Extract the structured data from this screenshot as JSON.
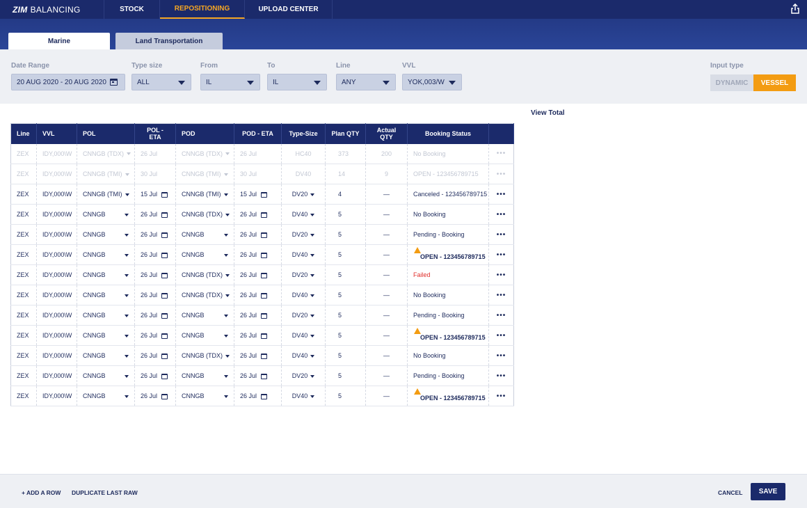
{
  "brand": {
    "bold": "ZIM",
    "name": "BALANCING"
  },
  "nav": {
    "tabs": [
      "STOCK",
      "REPOSITIONING",
      "UPLOAD CENTER"
    ],
    "active": "REPOSITIONING"
  },
  "subtabs": {
    "marine": "Marine",
    "land": "Land Transportation"
  },
  "filters": {
    "date_range": {
      "label": "Date Range",
      "value": "20 AUG 2020 - 20 AUG 2020"
    },
    "type_size": {
      "label": "Type size",
      "value": "ALL"
    },
    "from": {
      "label": "From",
      "value": "IL"
    },
    "to": {
      "label": "To",
      "value": "IL"
    },
    "line": {
      "label": "Line",
      "value": "ANY"
    },
    "vvl": {
      "label": "VVL",
      "value": "YOK,003/W"
    },
    "input_type": {
      "label": "Input type",
      "options": [
        "DYNAMIC",
        "VESSEL"
      ],
      "selected": "VESSEL"
    }
  },
  "view_total": "View Total",
  "table": {
    "headers": [
      "Line",
      "VVL",
      "POL",
      "POL - ETA",
      "POD",
      "POD - ETA",
      "Type-Size",
      "Plan QTY",
      "Actual QTY",
      "Booking Status",
      ""
    ],
    "rows": [
      {
        "line": "ZEX",
        "vvl": "IDY,000\\W",
        "pol": "CNNGB (TDX)",
        "pol_eta": "26 Jul",
        "pod": "CNNGB (TDX)",
        "pod_eta": "26 Jul",
        "type": "HC40",
        "plan": "373",
        "actual": "200",
        "status": "No Booking",
        "dim": true
      },
      {
        "line": "ZEX",
        "vvl": "IDY,000\\W",
        "pol": "CNNGB (TMI)",
        "pol_eta": "30 Jul",
        "pod": "CNNGB (TMI)",
        "pod_eta": "30 Jul",
        "type": "DV40",
        "plan": "14",
        "actual": "9",
        "status": "OPEN - 123456789715",
        "dim": true
      },
      {
        "line": "ZEX",
        "vvl": "IDY,000\\W",
        "pol": "CNNGB (TMI)",
        "pol_eta": "15 Jul",
        "pod": "CNNGB (TMI)",
        "pod_eta": "15 Jul",
        "type": "DV20",
        "plan": "4",
        "actual": "—",
        "status": "Canceled - 123456789715"
      },
      {
        "line": "ZEX",
        "vvl": "IDY,000\\W",
        "pol": "CNNGB",
        "pol_eta": "26 Jul",
        "pod": "CNNGB (TDX)",
        "pod_eta": "26 Jul",
        "type": "DV40",
        "plan": "5",
        "actual": "—",
        "status": "No Booking"
      },
      {
        "line": "ZEX",
        "vvl": "IDY,000\\W",
        "pol": "CNNGB",
        "pol_eta": "26 Jul",
        "pod": "CNNGB",
        "pod_eta": "26 Jul",
        "type": "DV20",
        "plan": "5",
        "actual": "—",
        "status": "Pending  - Booking"
      },
      {
        "line": "ZEX",
        "vvl": "IDY,000\\W",
        "pol": "CNNGB",
        "pol_eta": "26 Jul",
        "pod": "CNNGB",
        "pod_eta": "26 Jul",
        "type": "DV40",
        "plan": "5",
        "actual": "—",
        "status": "OPEN - 123456789715",
        "warn": true
      },
      {
        "line": "ZEX",
        "vvl": "IDY,000\\W",
        "pol": "CNNGB",
        "pol_eta": "26 Jul",
        "pod": "CNNGB (TDX)",
        "pod_eta": "26 Jul",
        "type": "DV20",
        "plan": "5",
        "actual": "—",
        "status": "Failed",
        "failed": true
      },
      {
        "line": "ZEX",
        "vvl": "IDY,000\\W",
        "pol": "CNNGB",
        "pol_eta": "26 Jul",
        "pod": "CNNGB (TDX)",
        "pod_eta": "26 Jul",
        "type": "DV40",
        "plan": "5",
        "actual": "—",
        "status": "No Booking"
      },
      {
        "line": "ZEX",
        "vvl": "IDY,000\\W",
        "pol": "CNNGB",
        "pol_eta": "26 Jul",
        "pod": "CNNGB",
        "pod_eta": "26 Jul",
        "type": "DV20",
        "plan": "5",
        "actual": "—",
        "status": "Pending  - Booking"
      },
      {
        "line": "ZEX",
        "vvl": "IDY,000\\W",
        "pol": "CNNGB",
        "pol_eta": "26 Jul",
        "pod": "CNNGB",
        "pod_eta": "26 Jul",
        "type": "DV40",
        "plan": "5",
        "actual": "—",
        "status": "OPEN - 123456789715",
        "warn": true
      },
      {
        "line": "ZEX",
        "vvl": "IDY,000\\W",
        "pol": "CNNGB",
        "pol_eta": "26 Jul",
        "pod": "CNNGB (TDX)",
        "pod_eta": "26 Jul",
        "type": "DV40",
        "plan": "5",
        "actual": "—",
        "status": "No Booking"
      },
      {
        "line": "ZEX",
        "vvl": "IDY,000\\W",
        "pol": "CNNGB",
        "pol_eta": "26 Jul",
        "pod": "CNNGB",
        "pod_eta": "26 Jul",
        "type": "DV20",
        "plan": "5",
        "actual": "—",
        "status": "Pending  - Booking"
      },
      {
        "line": "ZEX",
        "vvl": "IDY,000\\W",
        "pol": "CNNGB",
        "pol_eta": "26 Jul",
        "pod": "CNNGB",
        "pod_eta": "26 Jul",
        "type": "DV40",
        "plan": "5",
        "actual": "—",
        "status": "OPEN - 123456789715",
        "warn": true
      }
    ],
    "row_menu": "•••"
  },
  "footer": {
    "add_row": "+ ADD A ROW",
    "duplicate": "DUPLICATE LAST RAW",
    "cancel": "CANCEL",
    "save": "SAVE"
  },
  "icons": {
    "share": "share-icon",
    "calendar": "calendar-icon",
    "dropdown": "chevron-down-icon",
    "warning": "warning-icon",
    "more": "more-icon"
  },
  "colors": {
    "navy": "#1b2a6b",
    "accent": "#f39c12",
    "failed": "#e0302c"
  }
}
